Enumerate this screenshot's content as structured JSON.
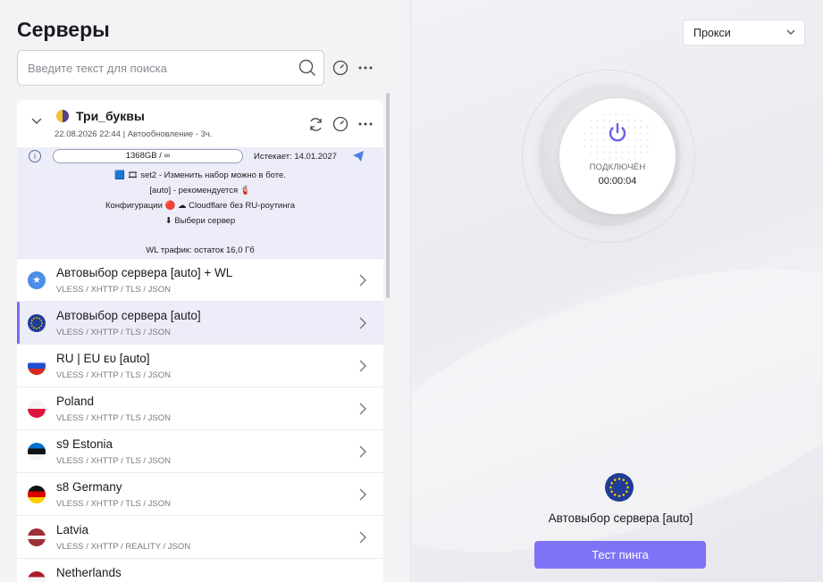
{
  "left": {
    "title": "Серверы",
    "search_placeholder": "Введите текст для поиска"
  },
  "subscription": {
    "name": "Три_буквы",
    "meta": "22.08.2026 22:44 | Автообновление - 3ч.",
    "traffic": "1368GB / ∞",
    "expires": "Истекает: 14.01.2027",
    "info_lines": [
      "🟦 🎞 set2 - Изменить набор можно в боте.",
      "[auto] - рекомендуется 🧯",
      "Конфигурации 🔴 ☁ Cloudflare без RU-роутинга",
      "⬇ Выбери сервер",
      "WL трафик: остаток 16,0 Гб"
    ]
  },
  "servers": [
    {
      "name": "Автовыбор сервера [auto] + WL",
      "proto": "VLESS / XHTTP / TLS / JSON",
      "flag": "globe"
    },
    {
      "name": "Автовыбор сервера [auto]",
      "proto": "VLESS / XHTTP / TLS / JSON",
      "flag": "eu"
    },
    {
      "name": "RU | EU ᴇᴜ [auto]",
      "proto": "VLESS / XHTTP / TLS / JSON",
      "flag": "ru"
    },
    {
      "name": "Poland",
      "proto": "VLESS / XHTTP / TLS / JSON",
      "flag": "pl"
    },
    {
      "name": "s9 Estonia",
      "proto": "VLESS / XHTTP / TLS / JSON",
      "flag": "ee"
    },
    {
      "name": "s8 Germany",
      "proto": "VLESS / XHTTP / TLS / JSON",
      "flag": "de"
    },
    {
      "name": "Latvia",
      "proto": "VLESS / XHTTP / REALITY / JSON",
      "flag": "lv"
    },
    {
      "name": "Netherlands",
      "proto": "",
      "flag": "nl"
    }
  ],
  "right": {
    "mode": "Прокси",
    "status": "ПОДКЛЮЧЁН",
    "timer": "00:00:04",
    "current_server": "Автовыбор сервера [auto]",
    "ping_button": "Тест пинга"
  },
  "colors": {
    "accent": "#7f73f5",
    "selected_bg": "#ecedf8",
    "power_icon": "#6b5cf0"
  }
}
